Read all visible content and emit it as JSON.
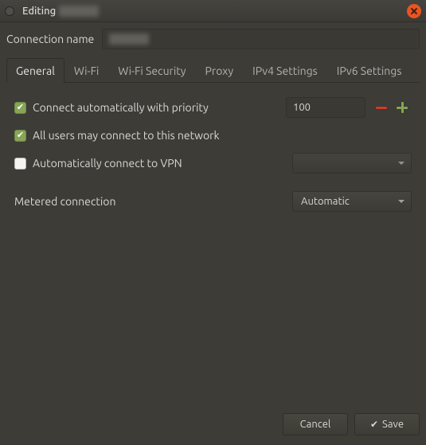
{
  "window": {
    "title_prefix": "Editing"
  },
  "conn": {
    "name_label": "Connection name"
  },
  "tabs": [
    {
      "label": "General",
      "active": true
    },
    {
      "label": "Wi-Fi",
      "active": false
    },
    {
      "label": "Wi-Fi Security",
      "active": false
    },
    {
      "label": "Proxy",
      "active": false
    },
    {
      "label": "IPv4 Settings",
      "active": false
    },
    {
      "label": "IPv6 Settings",
      "active": false
    }
  ],
  "general": {
    "auto_connect": {
      "label": "Connect automatically with priority",
      "checked": true,
      "priority": "100"
    },
    "all_users": {
      "label": "All users may connect to this network",
      "checked": true
    },
    "auto_vpn": {
      "label": "Automatically connect to VPN",
      "checked": false,
      "vpn_selected": ""
    },
    "metered": {
      "label": "Metered connection",
      "value": "Automatic"
    }
  },
  "footer": {
    "cancel": "Cancel",
    "save": "Save"
  }
}
